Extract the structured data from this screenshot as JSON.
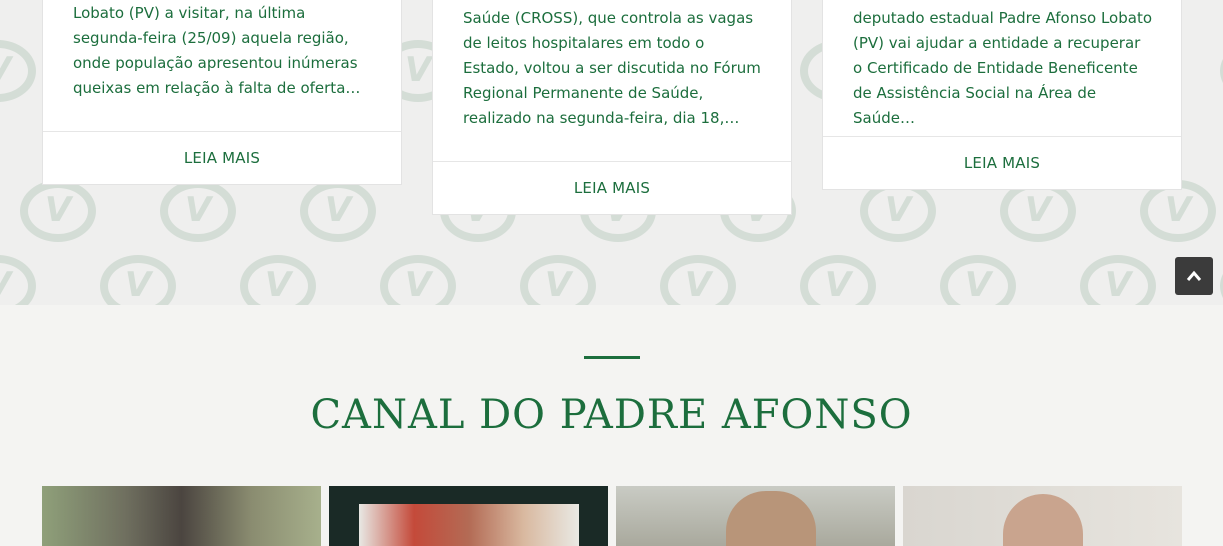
{
  "cards": [
    {
      "excerpt": "Lobato (PV) a visitar, na última segunda-feira (25/09) aquela região, onde população apresentou inúmeras queixas em relação à falta de oferta…",
      "link_label": "LEIA MAIS"
    },
    {
      "excerpt": "Saúde (CROSS), que controla as vagas de leitos hospitalares em todo o Estado, voltou a ser discutida no Fórum Regional Permanente de Saúde, realizado na segunda-feira, dia 18,…",
      "link_label": "LEIA MAIS"
    },
    {
      "excerpt": "deputado estadual Padre Afonso Lobato (PV) vai ajudar a entidade a recuperar o Certificado de Entidade Beneficente de Assistência Social na Área de Saúde…",
      "link_label": "LEIA MAIS"
    }
  ],
  "section": {
    "title": "CANAL DO PADRE AFONSO"
  },
  "icons": {
    "scroll_top": "chevron-up-icon",
    "pattern": "green-v-logo"
  },
  "colors": {
    "brand_green": "#1c6e3d",
    "pattern": "#d4ddd6",
    "scroll_button": "#3b3b3b"
  }
}
